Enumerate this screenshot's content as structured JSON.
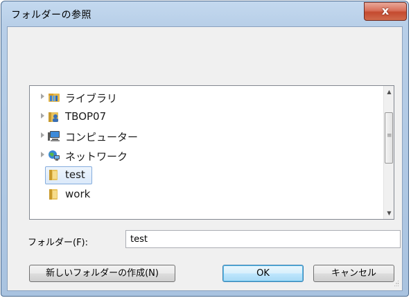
{
  "window": {
    "title": "フォルダーの参照",
    "close_glyph": "x"
  },
  "tree": {
    "items": [
      {
        "label": "ライブラリ",
        "icon": "library-icon",
        "expandable": true
      },
      {
        "label": "TBOP07",
        "icon": "user-folder-icon",
        "expandable": true
      },
      {
        "label": "コンピューター",
        "icon": "computer-icon",
        "expandable": true
      },
      {
        "label": "ネットワーク",
        "icon": "network-icon",
        "expandable": true
      },
      {
        "label": "test",
        "icon": "folder-icon",
        "expandable": false,
        "selected": true
      },
      {
        "label": "work",
        "icon": "folder-icon",
        "expandable": false
      }
    ]
  },
  "folder_field": {
    "label": "フォルダー(F):",
    "value": "test"
  },
  "buttons": {
    "new_folder": "新しいフォルダーの作成(N)",
    "ok": "OK",
    "cancel": "キャンセル"
  },
  "colors": {
    "title_bar": "#b8cfe8",
    "close_button": "#c44a2f",
    "selection_fill": "#dbe9fa",
    "selection_border": "#84acdd",
    "default_button": "#bee6fd"
  }
}
